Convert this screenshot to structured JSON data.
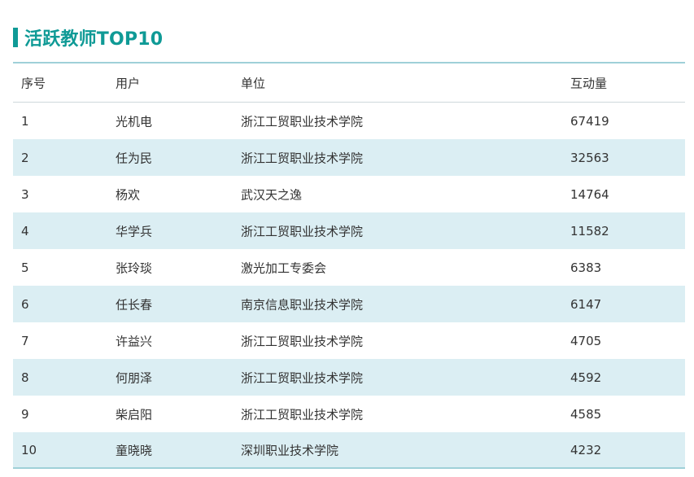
{
  "panel": {
    "title": "活跃教师TOP10"
  },
  "table": {
    "headers": [
      "序号",
      "用户",
      "单位",
      "互动量"
    ],
    "rows": [
      [
        "1",
        "光机电",
        "浙江工贸职业技术学院",
        "67419"
      ],
      [
        "2",
        "任为民",
        "浙江工贸职业技术学院",
        "32563"
      ],
      [
        "3",
        "杨欢",
        "武汉天之逸",
        "14764"
      ],
      [
        "4",
        "华学兵",
        "浙江工贸职业技术学院",
        "11582"
      ],
      [
        "5",
        "张玲琰",
        "激光加工专委会",
        "6383"
      ],
      [
        "6",
        "任长春",
        "南京信息职业技术学院",
        "6147"
      ],
      [
        "7",
        "许益兴",
        "浙江工贸职业技术学院",
        "4705"
      ],
      [
        "8",
        "何朋泽",
        "浙江工贸职业技术学院",
        "4592"
      ],
      [
        "9",
        "柴启阳",
        "浙江工贸职业技术学院",
        "4585"
      ],
      [
        "10",
        "童晓晓",
        "深圳职业技术学院",
        "4232"
      ]
    ]
  },
  "colors": {
    "accent": "#0f9a96",
    "row_alt_bg": "#dbeef3",
    "table_border": "#9fd0d8",
    "text": "#333333"
  }
}
